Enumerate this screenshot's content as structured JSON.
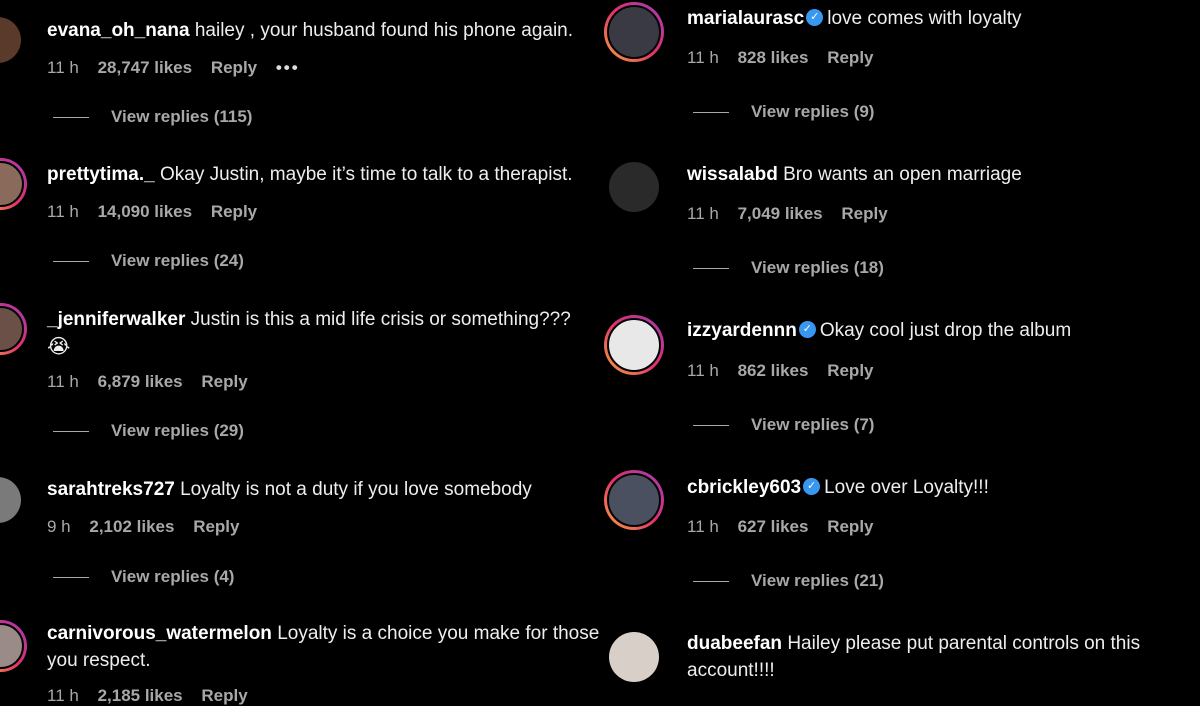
{
  "left": [
    {
      "user": "evana_oh_nana",
      "text": "hailey , your husband found his phone again.",
      "time": "11 h",
      "likes": "28,747 likes",
      "reply": "Reply",
      "more": "•••",
      "view_replies": "View replies (115)"
    },
    {
      "user": "prettytima._",
      "text": "Okay Justin, maybe it’s time to talk to a therapist.",
      "time": "11 h",
      "likes": "14,090 likes",
      "reply": "Reply",
      "view_replies": "View replies (24)"
    },
    {
      "user": "_jenniferwalker",
      "text": "Justin is this a mid life crisis or something???",
      "emoji": "😭",
      "time": "11 h",
      "likes": "6,879 likes",
      "reply": "Reply",
      "view_replies": "View replies (29)"
    },
    {
      "user": "sarahtreks727",
      "text": "Loyalty is not a duty if you love somebody",
      "time": "9 h",
      "likes": "2,102 likes",
      "reply": "Reply",
      "view_replies": "View replies (4)"
    },
    {
      "user": "carnivorous_watermelon",
      "text": "Loyalty is a choice you make for those you respect.",
      "time": "11 h",
      "likes": "2,185 likes",
      "reply": "Reply"
    }
  ],
  "right": [
    {
      "user": "marialaurasc",
      "verified": "✓",
      "text": "love comes with loyalty",
      "time": "11 h",
      "likes": "828 likes",
      "reply": "Reply",
      "view_replies": "View replies (9)"
    },
    {
      "user": "wissalabd",
      "text": "Bro wants an open marriage",
      "time": "11 h",
      "likes": "7,049 likes",
      "reply": "Reply",
      "view_replies": "View replies (18)"
    },
    {
      "user": "izzyardennn",
      "verified": "✓",
      "text": "Okay cool just drop the album",
      "time": "11 h",
      "likes": "862 likes",
      "reply": "Reply",
      "view_replies": "View replies (7)"
    },
    {
      "user": "cbrickley603",
      "verified": "✓",
      "text": "Love over Loyalty!!!",
      "time": "11 h",
      "likes": "627 likes",
      "reply": "Reply",
      "view_replies": "View replies (21)"
    },
    {
      "user": "duabeefan",
      "text": "Hailey please put parental controls on this account!!!!"
    }
  ],
  "colors": {
    "background": "#000000",
    "text": "#f5f5f5",
    "muted": "#a8a8a8",
    "verified": "#3897f0"
  }
}
